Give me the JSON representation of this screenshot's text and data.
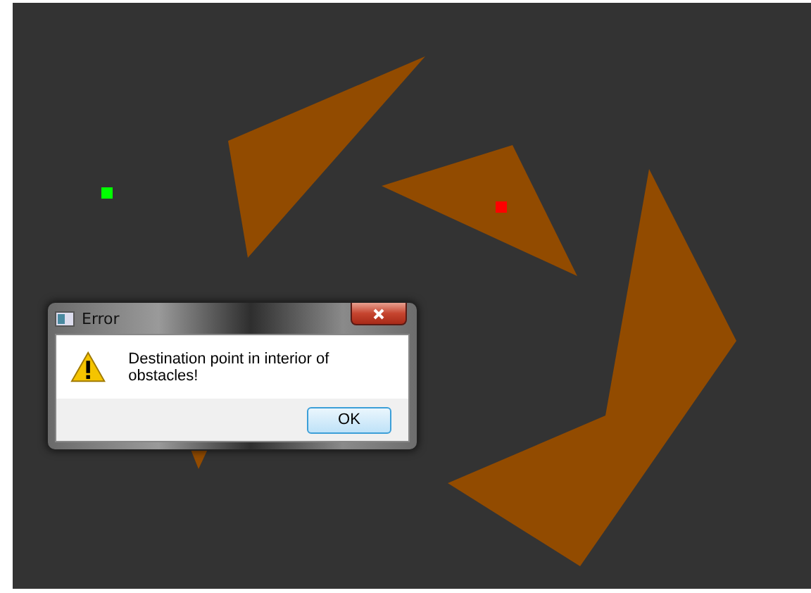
{
  "canvas": {
    "markers": [
      {
        "kind": "start",
        "color": "#00ff00"
      },
      {
        "kind": "destination",
        "color": "#ff0000"
      }
    ]
  },
  "dialog": {
    "title": "Error",
    "message": "Destination point in interior of obstacles!",
    "buttons": [
      "OK"
    ]
  }
}
